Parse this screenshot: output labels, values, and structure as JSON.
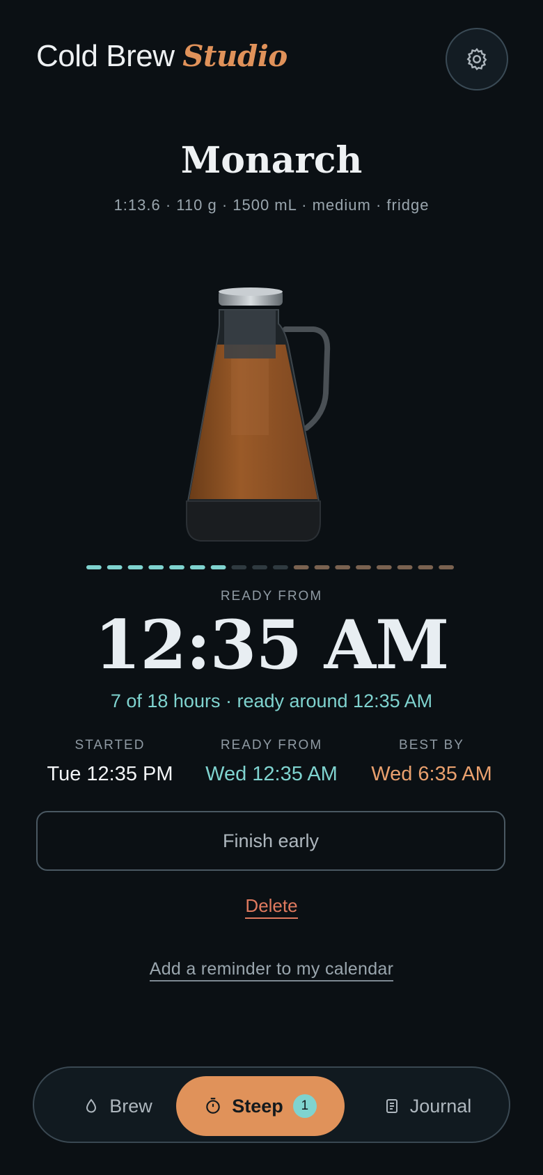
{
  "header": {
    "title": "Cold Brew",
    "accent": "Studio"
  },
  "brew": {
    "name": "Monarch",
    "details": "1:13.6 · 110 g · 1500 mL · medium · fridge",
    "progress": {
      "elapsed_hours": 7,
      "total_hours": 18,
      "ready_segment_end": 10
    }
  },
  "status": {
    "label": "READY FROM",
    "time": "12:35 AM",
    "progress_text": "7 of 18 hours · ready around 12:35 AM"
  },
  "times": {
    "started_label": "STARTED",
    "started_value": "Tue 12:35 PM",
    "ready_label": "READY FROM",
    "ready_value": "Wed 12:35 AM",
    "best_label": "BEST BY",
    "best_value": "Wed 6:35 AM"
  },
  "actions": {
    "finish": "Finish early",
    "delete": "Delete",
    "reminder": "Add a reminder to my calendar"
  },
  "nav": {
    "brew": "Brew",
    "steep": "Steep",
    "steep_badge": "1",
    "journal": "Journal"
  },
  "icons": {
    "settings": "gear-icon",
    "brew": "droplet-icon",
    "steep": "timer-icon",
    "journal": "document-icon"
  },
  "colors": {
    "accent": "#e0925a",
    "teal": "#7fd3cf",
    "danger": "#e07a5f",
    "background": "#0b1014"
  }
}
